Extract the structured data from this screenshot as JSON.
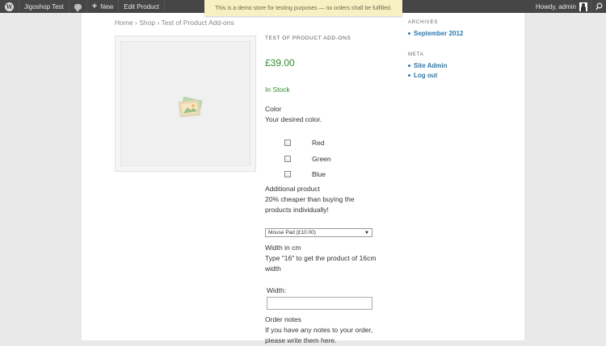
{
  "admin_bar": {
    "site_name": "Jigoshop Test",
    "new_label": "New",
    "edit_label": "Edit Product",
    "howdy": "Howdy, admin"
  },
  "demo_notice": "This is a demo store for testing purposes — no orders shall be fulfilled.",
  "breadcrumb": "Home › Shop › Test of Product Add-ons",
  "product": {
    "title": "TEST OF PRODUCT ADD-ONS",
    "price": "£39.00",
    "stock": "In Stock"
  },
  "addons": {
    "color_title": "Color",
    "color_desc": "Your desired color.",
    "color_options": [
      "Red",
      "Green",
      "Blue"
    ],
    "additional_title": "Additional product",
    "additional_desc_1": "20% cheaper than buying the",
    "additional_desc_2": "products individually!",
    "additional_selected": "Mouse Pad (£10.00)",
    "width_title": "Width in cm",
    "width_desc_1": "Type \"16\" to get the product of 16cm",
    "width_desc_2": "width",
    "width_label": "Width:",
    "width_value": "",
    "notes_title": "Order notes",
    "notes_desc_1": "If you have any notes to your order,",
    "notes_desc_2": "please write them here."
  },
  "sidebar": {
    "archives_title": "ARCHIVES",
    "archives_link": "September 2012",
    "meta_title": "META",
    "meta_links": [
      "Site Admin",
      "Log out"
    ]
  },
  "colors": {
    "admin_bar": "#464646",
    "price_green": "#2d8c2d",
    "link_blue": "#2a7ab0",
    "notice_bg": "#f7f0c3"
  }
}
